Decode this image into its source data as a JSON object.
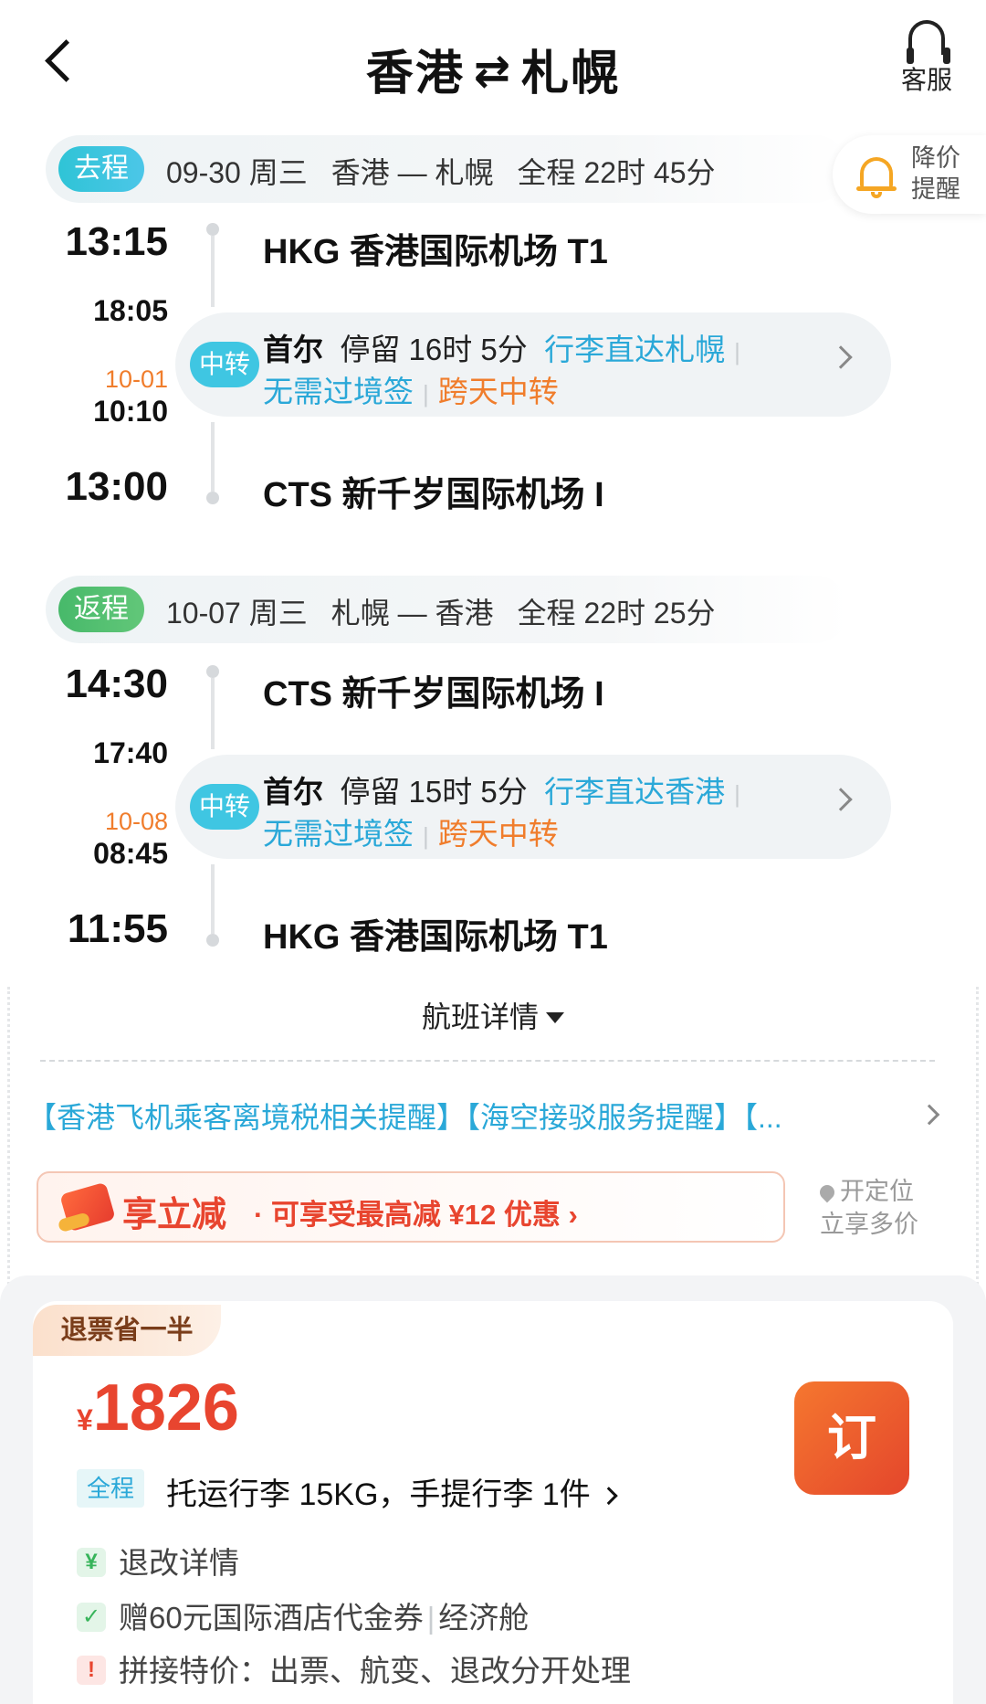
{
  "header": {
    "title_from": "香港",
    "title_to": "札幌",
    "swap_symbol": "⇄",
    "service_label": "客服"
  },
  "price_alert": {
    "line1": "降价",
    "line2": "提醒"
  },
  "outbound": {
    "tag": "去程",
    "date": "09-30 周三",
    "route": "香港 — 札幌",
    "duration": "全程 22时 45分",
    "depart_time": "13:15",
    "depart_airport": "HKG 香港国际机场 T1",
    "transfer_arrive": "18:05",
    "transfer_next_date": "10-01",
    "transfer_depart": "10:10",
    "transfer": {
      "tag": "中转",
      "city": "首尔",
      "stay": "停留 16时 5分",
      "baggage": "行李直达札幌",
      "visa": "无需过境签",
      "overnight": "跨天中转"
    },
    "arrive_time": "13:00",
    "arrive_airport": "CTS 新千岁国际机场 I"
  },
  "return": {
    "tag": "返程",
    "date": "10-07 周三",
    "route": "札幌 — 香港",
    "duration": "全程 22时 25分",
    "depart_time": "14:30",
    "depart_airport": "CTS 新千岁国际机场 I",
    "transfer_arrive": "17:40",
    "transfer_next_date": "10-08",
    "transfer_depart": "08:45",
    "transfer": {
      "tag": "中转",
      "city": "首尔",
      "stay": "停留 15时 5分",
      "baggage": "行李直达香港",
      "visa": "无需过境签",
      "overnight": "跨天中转"
    },
    "arrive_time": "11:55",
    "arrive_airport": "HKG 香港国际机场 T1"
  },
  "flight_details_label": "航班详情",
  "notices": "【香港飞机乘客离境税相关提醒】【海空接驳服务提醒】【...",
  "discount": {
    "big": "享立减",
    "small": "· 可享受最高减 ¥12 优惠  ›"
  },
  "locate": {
    "line1": "开定位",
    "line2": "立享多价"
  },
  "fare": {
    "badge": "退票省一半",
    "currency": "¥",
    "amount": "1826",
    "book_label": "订",
    "bag_tag": "全程",
    "bag_text": "托运行李 15KG，手提行李 1件",
    "features": {
      "refund": "退改详情",
      "gift": "赠60元国际酒店代金券",
      "cabin": "经济舱",
      "special": "拼接特价：出票、航变、退改分开处理"
    }
  },
  "colors": {
    "accent_orange": "#e8452f",
    "accent_blue": "#2aa8d8",
    "outbound_tag": "#2fc4d6",
    "return_tag": "#47b96a"
  }
}
